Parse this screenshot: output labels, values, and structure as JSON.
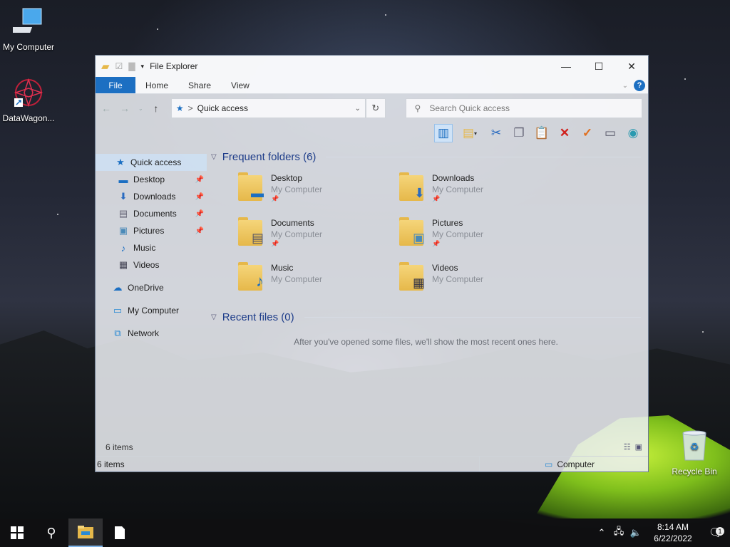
{
  "desktop": {
    "icons": [
      {
        "label": "My Computer",
        "icon": "monitor-icon"
      },
      {
        "label": "DataWagon...",
        "icon": "datawagon-icon"
      },
      {
        "label": "Recycle Bin",
        "icon": "recycle-bin-icon"
      }
    ]
  },
  "window": {
    "title": "File Explorer",
    "controls": {
      "minimize": "—",
      "maximize": "☐",
      "close": "✕"
    },
    "ribbon_tabs": [
      "File",
      "Home",
      "Share",
      "View"
    ],
    "address": {
      "path": "Quick access",
      "separator": ">"
    },
    "search": {
      "placeholder": "Search Quick access"
    },
    "nav_pane": [
      {
        "label": "Quick access",
        "icon": "star-icon",
        "pinned": false
      },
      {
        "label": "Desktop",
        "icon": "desktop-icon",
        "pinned": true
      },
      {
        "label": "Downloads",
        "icon": "download-icon",
        "pinned": true
      },
      {
        "label": "Documents",
        "icon": "documents-icon",
        "pinned": true
      },
      {
        "label": "Pictures",
        "icon": "pictures-icon",
        "pinned": true
      },
      {
        "label": "Music",
        "icon": "music-icon",
        "pinned": false
      },
      {
        "label": "Videos",
        "icon": "videos-icon",
        "pinned": false
      },
      {
        "label": "OneDrive",
        "icon": "cloud-icon",
        "pinned": false
      },
      {
        "label": "My Computer",
        "icon": "computer-icon",
        "pinned": false
      },
      {
        "label": "Network",
        "icon": "network-icon",
        "pinned": false
      }
    ],
    "frequent_header": "Frequent folders (6)",
    "folders": [
      {
        "name": "Desktop",
        "location": "My Computer"
      },
      {
        "name": "Downloads",
        "location": "My Computer"
      },
      {
        "name": "Documents",
        "location": "My Computer"
      },
      {
        "name": "Pictures",
        "location": "My Computer"
      },
      {
        "name": "Music",
        "location": "My Computer"
      },
      {
        "name": "Videos",
        "location": "My Computer"
      }
    ],
    "recent_header": "Recent files (0)",
    "recent_empty": "After you've opened some files, we'll show the most recent ones here.",
    "item_count": "6 items",
    "status_items": "6 items",
    "status_location": "Computer"
  },
  "taskbar": {
    "time": "8:14 AM",
    "date": "6/22/2022",
    "notification_count": "1"
  }
}
